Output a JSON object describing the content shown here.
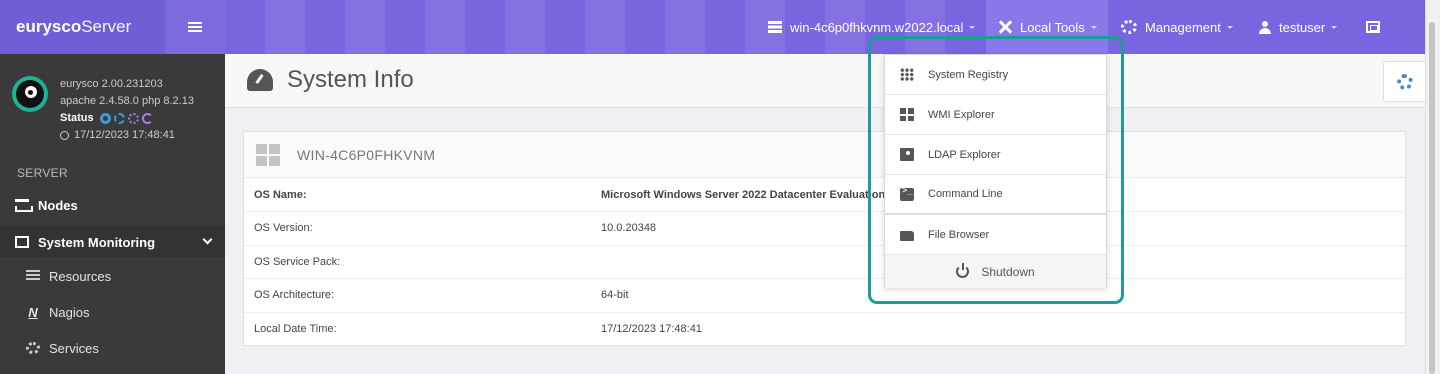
{
  "brand": {
    "bold": "eurysco",
    "light": "Server"
  },
  "sidebar": {
    "version": "eurysco 2.00.231203",
    "stack": "apache 2.4.58.0  php 8.2.13",
    "status_label": "Status",
    "timestamp": "17/12/2023 17:48:41",
    "section": "SERVER",
    "nodes": "Nodes",
    "monitoring": "System Monitoring",
    "resources": "Resources",
    "nagios": "Nagios",
    "nagios_icon": "N",
    "services": "Services"
  },
  "topbar": {
    "host": "win-4c6p0fhkvnm.w2022.local",
    "local_tools": "Local Tools",
    "management": "Management",
    "user": "testuser"
  },
  "page": {
    "title": "System Info",
    "panel_title": "WIN-4C6P0FHKVNM"
  },
  "info_rows": [
    {
      "key": "OS Name:",
      "value": "Microsoft Windows Server 2022 Datacenter Evaluation"
    },
    {
      "key": "OS Version:",
      "value": "10.0.20348"
    },
    {
      "key": "OS Service Pack:",
      "value": ""
    },
    {
      "key": "OS Architecture:",
      "value": "64-bit"
    },
    {
      "key": "Local Date Time:",
      "value": "17/12/2023 17:48:41"
    }
  ],
  "dropdown": {
    "items": [
      "System Registry",
      "WMI Explorer",
      "LDAP Explorer",
      "Command Line",
      "File Browser"
    ],
    "shutdown": "Shutdown"
  },
  "colors": {
    "accent": "#7a65e0",
    "highlight": "#1a9e96",
    "sidebar": "#3a3a3a"
  }
}
